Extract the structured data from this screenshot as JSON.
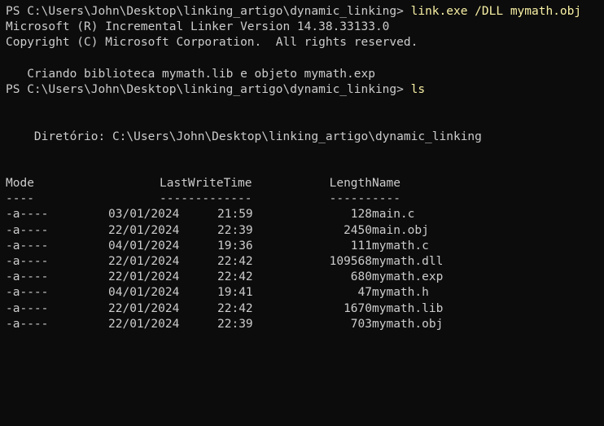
{
  "terminal": {
    "prompt": "PS C:\\Users\\John\\Desktop\\linking_artigo\\dynamic_linking>",
    "cmd1": "link.exe /DLL mymath.obj",
    "linker_line1": "Microsoft (R) Incremental Linker Version 14.38.33133.0",
    "linker_line2": "Copyright (C) Microsoft Corporation.  All rights reserved.",
    "linker_line3": "   Criando biblioteca mymath.lib e objeto mymath.exp",
    "cmd2": "ls",
    "directory_line": "    Diretório: C:\\Users\\John\\Desktop\\linking_artigo\\dynamic_linking"
  },
  "listing": {
    "headers": {
      "mode": "Mode",
      "lastwritetime": "LastWriteTime",
      "length": "Length",
      "name": "Name"
    },
    "underlines": {
      "mode": "----",
      "lastwritetime": "-------------",
      "length": "------",
      "name": "----"
    },
    "rows": [
      {
        "mode": "-a----",
        "date": "03/01/2024",
        "time": "21:59",
        "length": "128",
        "name": "main.c"
      },
      {
        "mode": "-a----",
        "date": "22/01/2024",
        "time": "22:39",
        "length": "2450",
        "name": "main.obj"
      },
      {
        "mode": "-a----",
        "date": "04/01/2024",
        "time": "19:36",
        "length": "111",
        "name": "mymath.c"
      },
      {
        "mode": "-a----",
        "date": "22/01/2024",
        "time": "22:42",
        "length": "109568",
        "name": "mymath.dll"
      },
      {
        "mode": "-a----",
        "date": "22/01/2024",
        "time": "22:42",
        "length": "680",
        "name": "mymath.exp"
      },
      {
        "mode": "-a----",
        "date": "04/01/2024",
        "time": "19:41",
        "length": "47",
        "name": "mymath.h"
      },
      {
        "mode": "-a----",
        "date": "22/01/2024",
        "time": "22:42",
        "length": "1670",
        "name": "mymath.lib"
      },
      {
        "mode": "-a----",
        "date": "22/01/2024",
        "time": "22:39",
        "length": "703",
        "name": "mymath.obj"
      }
    ]
  },
  "colors": {
    "background": "#0c0c0c",
    "text": "#cccccc",
    "command": "#f9f1a5"
  }
}
